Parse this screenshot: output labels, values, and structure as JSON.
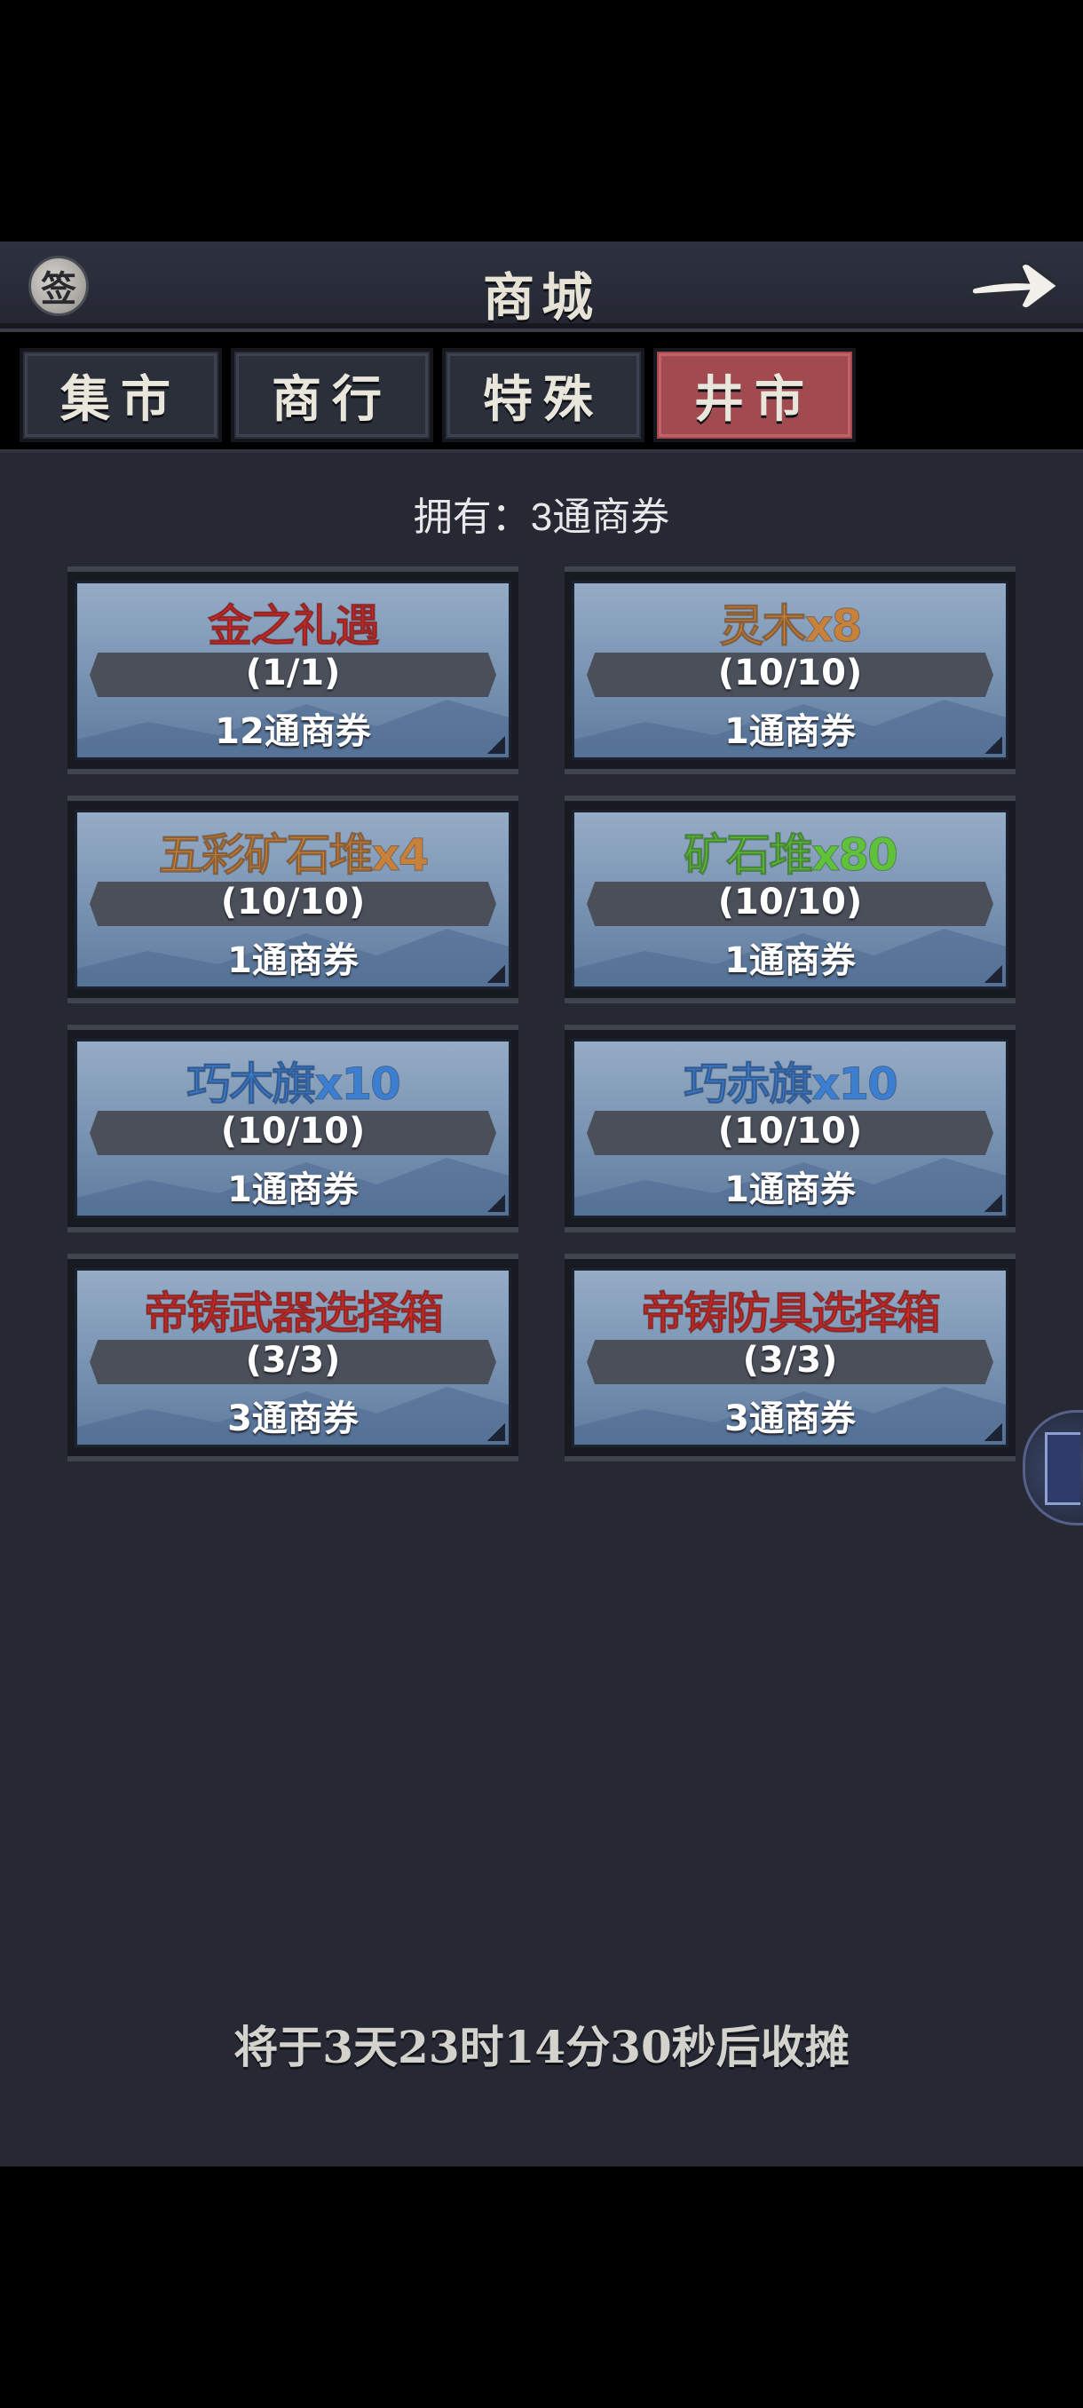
{
  "header": {
    "title": "商城",
    "sign_icon_glyph": "签",
    "back_icon": "arrow-right-icon"
  },
  "tabs": [
    {
      "label": "集市",
      "active": false
    },
    {
      "label": "商行",
      "active": false
    },
    {
      "label": "特殊",
      "active": false
    },
    {
      "label": "井市",
      "active": true
    }
  ],
  "owned_text": "拥有：3通商券",
  "items": [
    {
      "name": "金之礼遇",
      "stock": "(1/1)",
      "price": "12通商券",
      "color": "#d42a23"
    },
    {
      "name": "灵木x8",
      "stock": "(10/10)",
      "price": "1通商券",
      "color": "#c7813b"
    },
    {
      "name": "五彩矿石堆x4",
      "stock": "(10/10)",
      "price": "1通商券",
      "color": "#c7813b"
    },
    {
      "name": "矿石堆x80",
      "stock": "(10/10)",
      "price": "1通商券",
      "color": "#5fc23a"
    },
    {
      "name": "巧木旗x10",
      "stock": "(10/10)",
      "price": "1通商券",
      "color": "#3c7fd0"
    },
    {
      "name": "巧赤旗x10",
      "stock": "(10/10)",
      "price": "1通商券",
      "color": "#3c7fd0"
    },
    {
      "name": "帝铸武器选择箱",
      "stock": "(3/3)",
      "price": "3通商券",
      "color": "#d42a23"
    },
    {
      "name": "帝铸防具选择箱",
      "stock": "(3/3)",
      "price": "3通商券",
      "color": "#d42a23"
    }
  ],
  "countdown_text": "将于3天23时14分30秒后收摊"
}
